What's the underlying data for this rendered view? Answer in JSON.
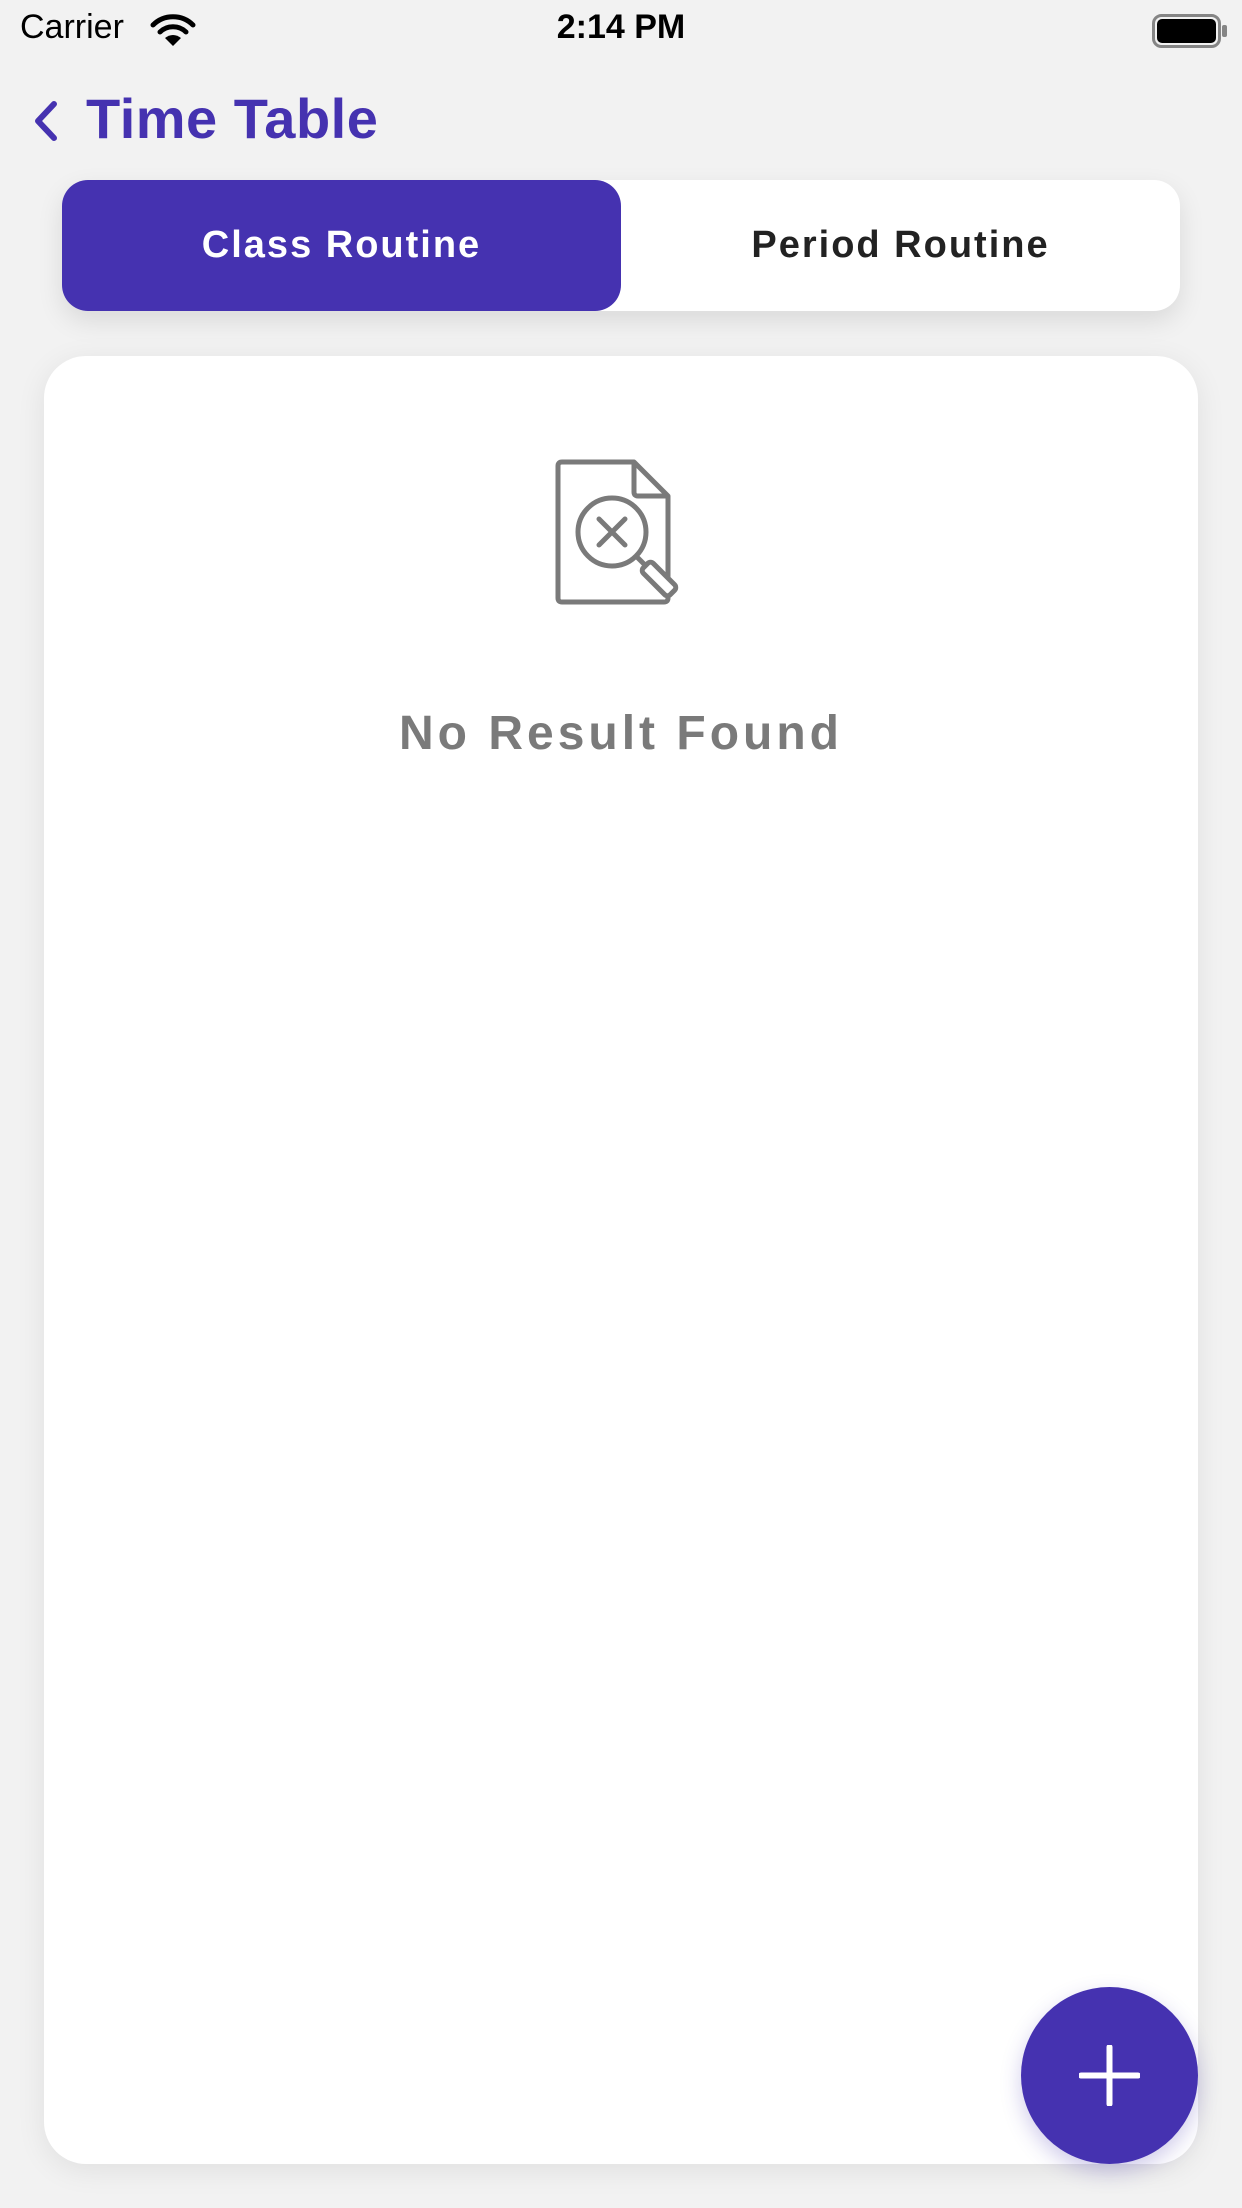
{
  "status_bar": {
    "carrier": "Carrier",
    "time": "2:14 PM",
    "icons": [
      "wifi-icon",
      "battery-icon"
    ]
  },
  "header": {
    "title": "Time Table",
    "back_icon": "chevron-left-icon"
  },
  "tabs": [
    {
      "label": "Class Routine",
      "active": true
    },
    {
      "label": "Period Routine",
      "active": false
    }
  ],
  "empty_state": {
    "icon": "document-search-x-icon",
    "message": "No Result Found"
  },
  "fab": {
    "icon": "plus-icon"
  },
  "colors": {
    "accent": "#4532b0",
    "background": "#f2f2f2",
    "card": "#ffffff",
    "muted_text": "#7a7a7a"
  }
}
